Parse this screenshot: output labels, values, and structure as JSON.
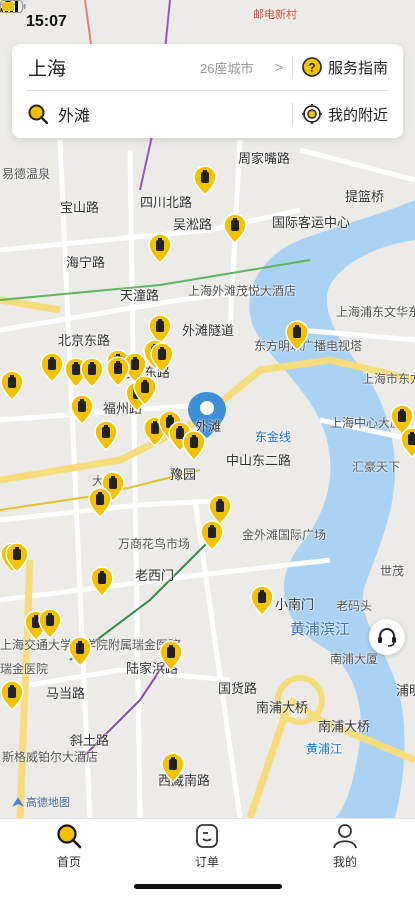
{
  "status_bar": {
    "time": "15:07"
  },
  "header": {
    "city": "上海",
    "city_count": "26座城市",
    "service_guide": "服务指南",
    "search_text": "外滩",
    "nearby": "我的附近"
  },
  "map": {
    "labels": [
      {
        "text": "邮电新村",
        "cls": "metro"
      },
      {
        "text": "易德温泉",
        "cls": ""
      },
      {
        "text": "宝山路",
        "cls": "road"
      },
      {
        "text": "四川北路",
        "cls": "road"
      },
      {
        "text": "周家嘴路",
        "cls": "road"
      },
      {
        "text": "提篮桥",
        "cls": "road"
      },
      {
        "text": "国际客运中心",
        "cls": "road"
      },
      {
        "text": "海宁路",
        "cls": "road"
      },
      {
        "text": "吴淞路",
        "cls": "road"
      },
      {
        "text": "天潼路",
        "cls": "road"
      },
      {
        "text": "上海外滩茂悦大酒店",
        "cls": ""
      },
      {
        "text": "上海浦东文华东方酒店",
        "cls": ""
      },
      {
        "text": "北京东路",
        "cls": "road"
      },
      {
        "text": "外滩隧道",
        "cls": "road"
      },
      {
        "text": "东方明珠广播电视塔",
        "cls": ""
      },
      {
        "text": "上海市东方",
        "cls": ""
      },
      {
        "text": "南京东路",
        "cls": "road"
      },
      {
        "text": "福州路",
        "cls": "road"
      },
      {
        "text": "外滩",
        "cls": "road"
      },
      {
        "text": "上海中心大厦",
        "cls": ""
      },
      {
        "text": "东金线",
        "cls": "blue"
      },
      {
        "text": "中山东二路",
        "cls": "road"
      },
      {
        "text": "豫园",
        "cls": "road"
      },
      {
        "text": "汇豪天下",
        "cls": ""
      },
      {
        "text": "大",
        "cls": ""
      },
      {
        "text": "金外滩国际广场",
        "cls": ""
      },
      {
        "text": "万商花鸟市场",
        "cls": ""
      },
      {
        "text": "老西门",
        "cls": "road"
      },
      {
        "text": "世茂",
        "cls": ""
      },
      {
        "text": "小南门",
        "cls": "road"
      },
      {
        "text": "老码头",
        "cls": ""
      },
      {
        "text": "黄浦滨江",
        "cls": "big"
      },
      {
        "text": "陆家浜路",
        "cls": "road"
      },
      {
        "text": "南浦大厦",
        "cls": ""
      },
      {
        "text": "马当路",
        "cls": "road"
      },
      {
        "text": "国货路",
        "cls": "road"
      },
      {
        "text": "南浦大桥",
        "cls": "road"
      },
      {
        "text": "南浦大桥",
        "cls": "road"
      },
      {
        "text": "浦明路",
        "cls": "road"
      },
      {
        "text": "斜土路",
        "cls": "road"
      },
      {
        "text": "瑞金医院",
        "cls": ""
      },
      {
        "text": "斯格威铂尔大酒店",
        "cls": ""
      },
      {
        "text": "西藏南路",
        "cls": "road"
      },
      {
        "text": "黄浦江",
        "cls": "blue"
      },
      {
        "text": "上海交通大学医学院附属瑞金医院",
        "cls": ""
      },
      {
        "text": "福州路",
        "cls": "road"
      }
    ]
  },
  "logo": "高德地图",
  "tabs": [
    {
      "label": "首页"
    },
    {
      "label": "订单"
    },
    {
      "label": "我的"
    }
  ],
  "colors": {
    "brand": "#f2c200",
    "river": "#a9d2f5",
    "active_tab": "#111111"
  }
}
